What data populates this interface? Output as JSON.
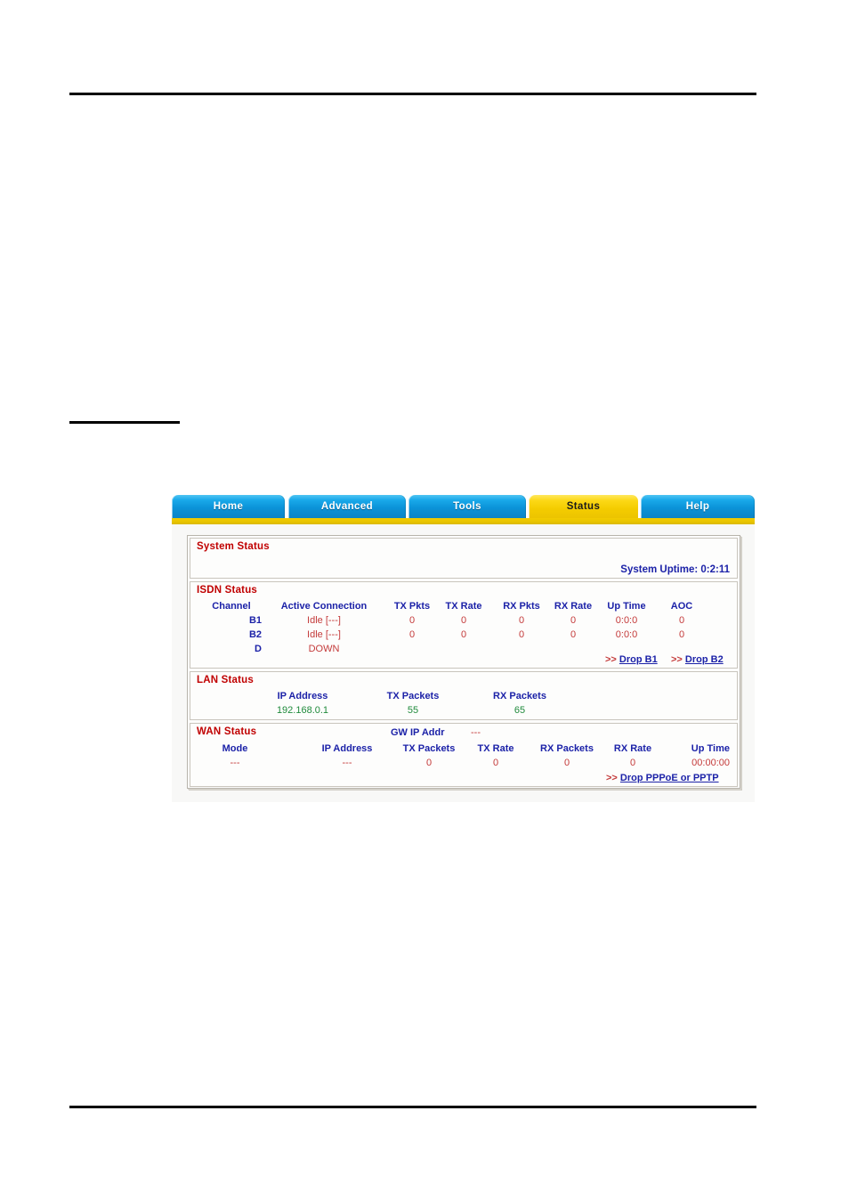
{
  "document": {
    "top_rule": true,
    "section_rule": true,
    "bottom_rule": true
  },
  "router_ui": {
    "tabs": [
      {
        "label": "Home",
        "active": false
      },
      {
        "label": "Advanced",
        "active": false
      },
      {
        "label": "Tools",
        "active": false
      },
      {
        "label": "Status",
        "active": true
      },
      {
        "label": "Help",
        "active": false
      }
    ],
    "system_status": {
      "title": "System Status",
      "uptime_label": "System Uptime: 0:2:11"
    },
    "isdn_status": {
      "title": "ISDN Status",
      "columns": [
        "Channel",
        "Active Connection",
        "TX Pkts",
        "TX Rate",
        "RX Pkts",
        "RX Rate",
        "Up Time",
        "AOC"
      ],
      "rows": [
        {
          "channel": "B1",
          "connection": "Idle [---]",
          "tx_pkts": "0",
          "tx_rate": "0",
          "rx_pkts": "0",
          "rx_rate": "0",
          "up_time": "0:0:0",
          "aoc": "0"
        },
        {
          "channel": "B2",
          "connection": "Idle [---]",
          "tx_pkts": "0",
          "tx_rate": "0",
          "rx_pkts": "0",
          "rx_rate": "0",
          "up_time": "0:0:0",
          "aoc": "0"
        },
        {
          "channel": "D",
          "connection": "DOWN",
          "tx_pkts": "",
          "tx_rate": "",
          "rx_pkts": "",
          "rx_rate": "",
          "up_time": "",
          "aoc": ""
        }
      ],
      "drop_b1": {
        "arrow": ">>",
        "label": "Drop B1"
      },
      "drop_b2": {
        "arrow": ">>",
        "label": "Drop B2"
      }
    },
    "lan_status": {
      "title": "LAN Status",
      "columns": [
        "IP Address",
        "TX Packets",
        "RX Packets"
      ],
      "row": {
        "ip_address": "192.168.0.1",
        "tx_packets": "55",
        "rx_packets": "65"
      }
    },
    "wan_status": {
      "title": "WAN Status",
      "gw_label": "GW IP Addr",
      "gw_value": "---",
      "columns": [
        "Mode",
        "IP Address",
        "TX Packets",
        "TX Rate",
        "RX Packets",
        "RX Rate",
        "Up Time"
      ],
      "row": {
        "mode": "---",
        "ip_address": "---",
        "tx_packets": "0",
        "tx_rate": "0",
        "rx_packets": "0",
        "rx_rate": "0",
        "up_time": "00:00:00"
      },
      "drop_wan": {
        "arrow": ">>",
        "label": "Drop PPPoE or PPTP"
      }
    },
    "colors": {
      "tab_active": "#f4cc00",
      "tab_inactive": "#0b93d8",
      "heading_red": "#c00000",
      "header_blue": "#1c22a8",
      "value_red": "#c43a3a",
      "value_green": "#1f8a3b"
    }
  }
}
